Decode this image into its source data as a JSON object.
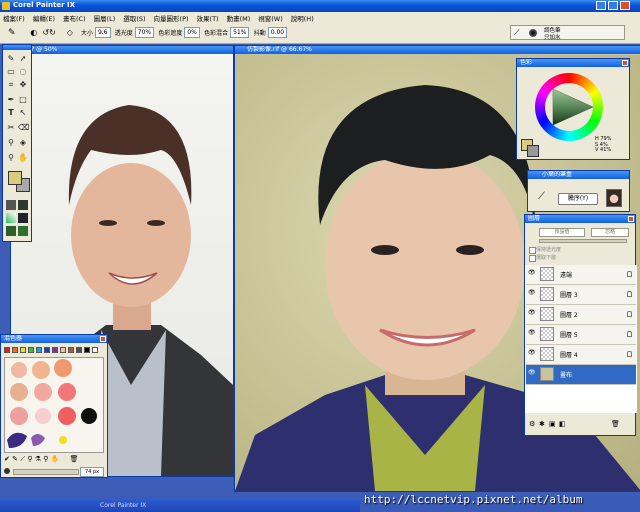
{
  "app": {
    "title": "Corel Painter IX"
  },
  "menu": [
    "檔案(F)",
    "編輯(E)",
    "畫布(C)",
    "圖層(L)",
    "選取(S)",
    "向量圖形(P)",
    "效果(T)",
    "動畫(M)",
    "視窗(W)",
    "說明(H)"
  ],
  "toolbar": {
    "size_label": "大小",
    "size_value": "9.6",
    "opacity_label": "透光度",
    "opacity_value": "70%",
    "resat_label": "色彩遮度",
    "resat_value": "0%",
    "bleed_label": "色彩混合",
    "bleed_value": "51%",
    "jitter_label": "抖動",
    "jitter_value": "0.00",
    "brush_category": "調色筆",
    "brush_variant": "只加水"
  },
  "doc_left": {
    "title": "? @ 50%"
  },
  "doc_right": {
    "title": "仿製影像.rif @ 66.67%"
  },
  "color_panel": {
    "title": "色彩",
    "readout": [
      "H 79%",
      "S 4%",
      "V 41%"
    ]
  },
  "mixer_panel": {
    "title": "混色器",
    "size_value": "74 px"
  },
  "brush_panel": {
    "title": "小葉的筆盒",
    "button_label": "騰序(Y)"
  },
  "layers_panel": {
    "title": "圖層",
    "composite_method": "預設值",
    "depth": "忽略",
    "opt_preserve": "保持透光度",
    "opt_pick_up": "選取下層",
    "layers": [
      {
        "name": "遠端",
        "selected": false
      },
      {
        "name": "圖層 3",
        "selected": false
      },
      {
        "name": "圖層 2",
        "selected": false
      },
      {
        "name": "圖層 5",
        "selected": false
      },
      {
        "name": "圖層 4",
        "selected": false
      },
      {
        "name": "畫布",
        "selected": true
      }
    ]
  },
  "watermark": "http://lccnetvip.pixnet.net/album",
  "taskbar": {
    "item": "Corel Painter IX"
  },
  "colors": {
    "xp_blue": "#0a52d8",
    "panel_bg": "#ece9d8",
    "canvas_bg": "#c8c49a"
  }
}
